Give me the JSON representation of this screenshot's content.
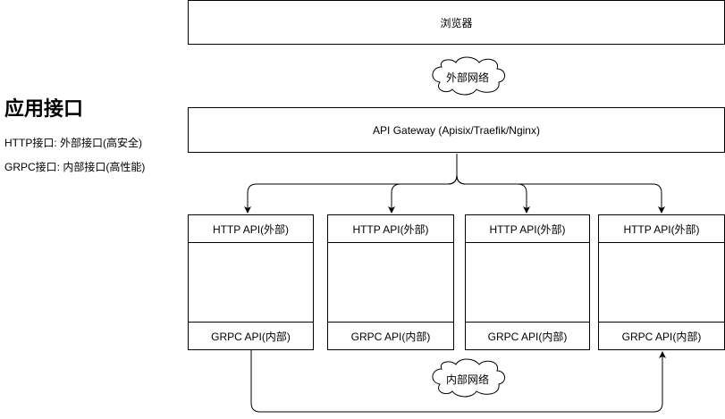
{
  "sidebar": {
    "title": "应用接口",
    "lines": [
      "HTTP接口: 外部接口(高安全)",
      "GRPC接口: 内部接口(高性能)"
    ]
  },
  "browser": {
    "label": "浏览器"
  },
  "external_network": {
    "label": "外部网络"
  },
  "gateway": {
    "label": "API Gateway (Apisix/Traefik/Nginx)"
  },
  "services": [
    {
      "http_label": "HTTP API(外部)",
      "grpc_label": "GRPC API(内部)"
    },
    {
      "http_label": "HTTP API(外部)",
      "grpc_label": "GRPC API(内部)"
    },
    {
      "http_label": "HTTP API(外部)",
      "grpc_label": "GRPC API(内部)"
    },
    {
      "http_label": "HTTP API(外部)",
      "grpc_label": "GRPC API(内部)"
    }
  ],
  "internal_network": {
    "label": "内部网络"
  }
}
